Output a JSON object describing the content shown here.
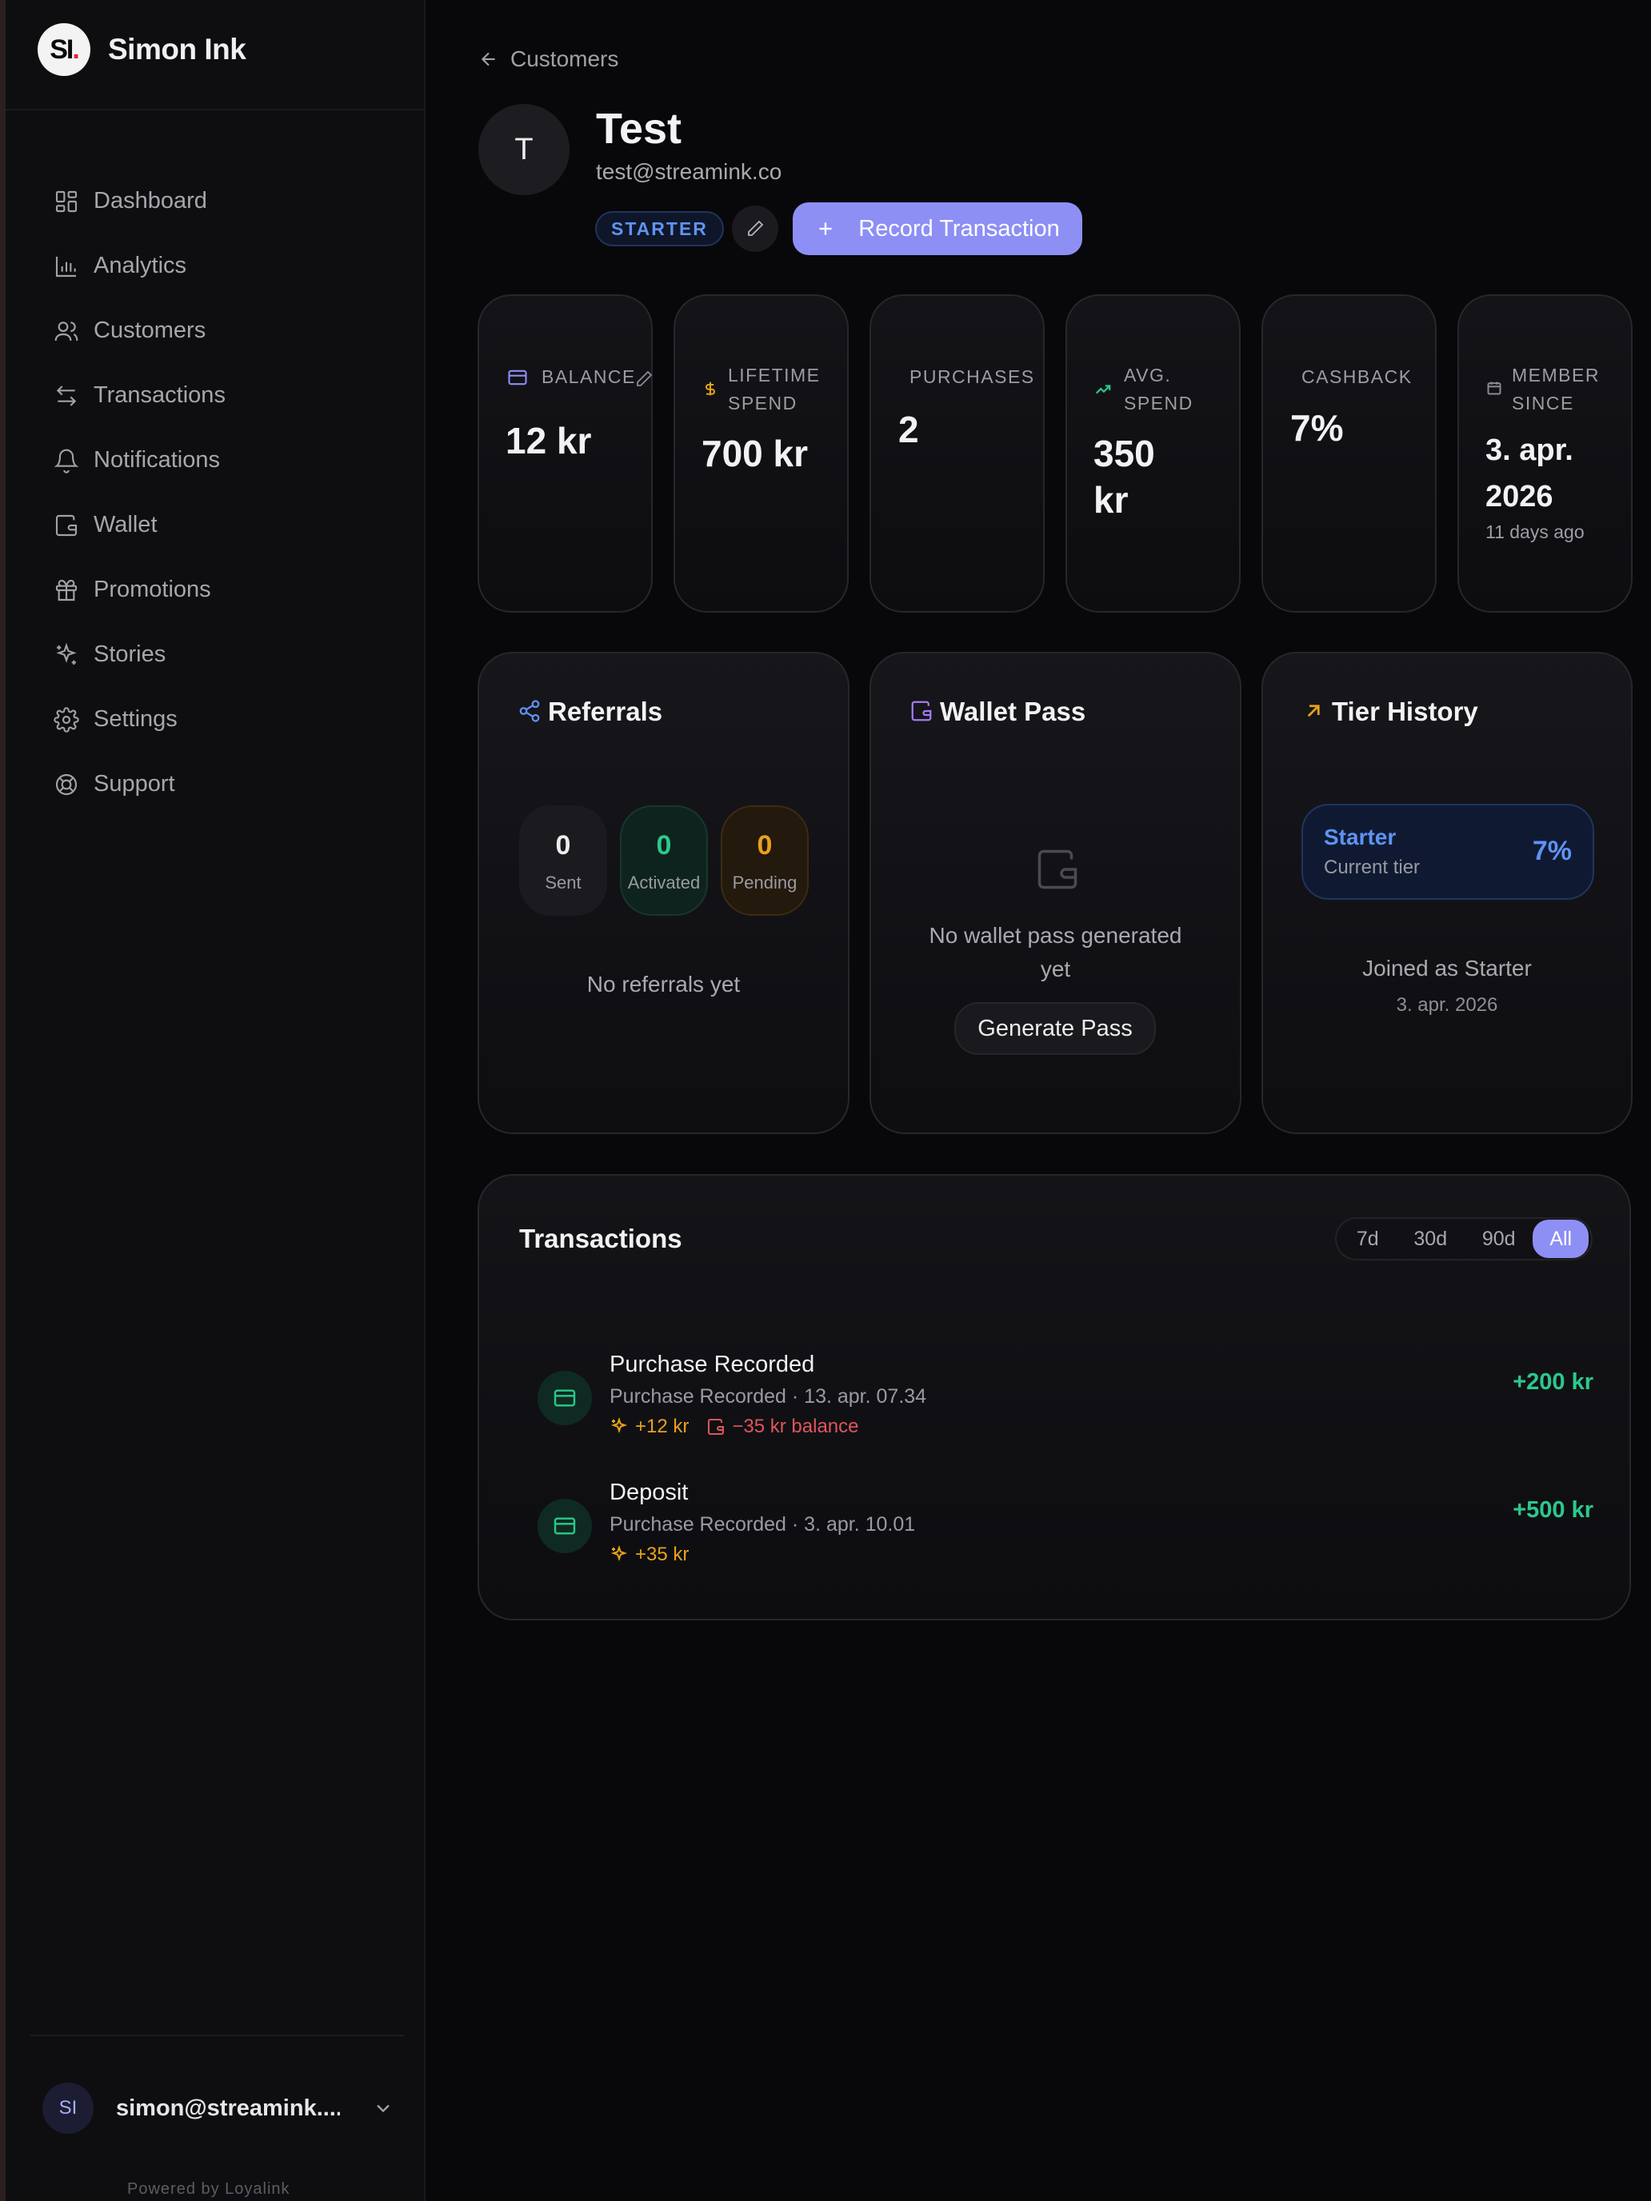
{
  "brand": {
    "logo_text": "SI",
    "logo_dot": ".",
    "name": "Simon Ink"
  },
  "sidebar": {
    "items": [
      {
        "label": "Dashboard",
        "icon": "dashboard-icon"
      },
      {
        "label": "Analytics",
        "icon": "bar-chart-icon"
      },
      {
        "label": "Customers",
        "icon": "users-icon"
      },
      {
        "label": "Transactions",
        "icon": "arrows-swap-icon"
      },
      {
        "label": "Notifications",
        "icon": "bell-icon"
      },
      {
        "label": "Wallet",
        "icon": "wallet-icon"
      },
      {
        "label": "Promotions",
        "icon": "gift-icon"
      },
      {
        "label": "Stories",
        "icon": "sparkles-icon"
      },
      {
        "label": "Settings",
        "icon": "gear-icon"
      },
      {
        "label": "Support",
        "icon": "lifebuoy-icon"
      }
    ],
    "user": {
      "initials": "SI",
      "email": "simon@streamink...."
    },
    "powered_by": "Powered by Loyalink"
  },
  "breadcrumb": {
    "label": "Customers"
  },
  "customer": {
    "initial": "T",
    "name": "Test",
    "email": "test@streamink.co",
    "tier_badge": "STARTER",
    "record_button": "Record Transaction"
  },
  "stats": {
    "balance": {
      "label": "BALANCE",
      "value": "12 kr"
    },
    "lifetime_spend": {
      "label_line1": "LIFETIME",
      "label_line2": "SPEND",
      "value": "700 kr"
    },
    "purchases": {
      "label": "PURCHASES",
      "value": "2"
    },
    "avg_spend": {
      "label_line1": "AVG.",
      "label_line2": "SPEND",
      "value_line1": "350",
      "value_line2": "kr"
    },
    "cashback": {
      "label": "CASHBACK",
      "value": "7%"
    },
    "member_since": {
      "label_line1": "MEMBER",
      "label_line2": "SINCE",
      "value_line1": "3. apr.",
      "value_line2": "2026",
      "sub": "11 days ago"
    }
  },
  "referrals": {
    "title": "Referrals",
    "sent": {
      "value": "0",
      "label": "Sent"
    },
    "activated": {
      "value": "0",
      "label": "Activated"
    },
    "pending": {
      "value": "0",
      "label": "Pending"
    },
    "empty_text": "No referrals yet"
  },
  "wallet_pass": {
    "title": "Wallet Pass",
    "empty_line1": "No wallet pass generated",
    "empty_line2": "yet",
    "button": "Generate Pass"
  },
  "tier_history": {
    "title": "Tier History",
    "current_tier": "Starter",
    "current_label": "Current tier",
    "rate": "7%",
    "joined_text": "Joined as Starter",
    "joined_date": "3. apr. 2026"
  },
  "transactions": {
    "title": "Transactions",
    "ranges": [
      "7d",
      "30d",
      "90d",
      "All"
    ],
    "active_range": "All",
    "rows": [
      {
        "name": "Purchase Recorded",
        "meta": "Purchase Recorded · 13. apr. 07.34",
        "points": "+12 kr",
        "balance": "−35 kr balance",
        "amount": "+200 kr"
      },
      {
        "name": "Deposit",
        "meta": "Purchase Recorded · 3. apr. 10.01",
        "points": "+35 kr",
        "amount": "+500 kr"
      }
    ]
  },
  "colors": {
    "accent": "#8d8ff5",
    "positive": "#2bc98c",
    "negative": "#e0555b",
    "warning": "#e8a21a",
    "tier_blue": "#5f93f2"
  }
}
